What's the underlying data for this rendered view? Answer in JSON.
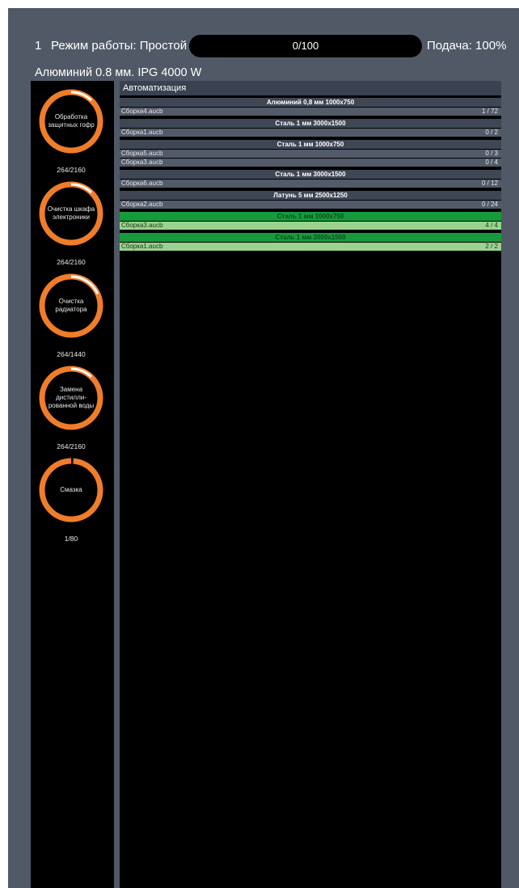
{
  "status": {
    "machine_number": "1",
    "mode_text": "Режим работы: Простой",
    "progress_text": "0/100",
    "progress_fraction": 0,
    "feed_text": "Подача: 100%",
    "material_text": "Алюминий 0.8 мм. IPG 4000 W"
  },
  "maintenance": [
    {
      "label": "Обработка защитных гофр",
      "count": "264/2160",
      "fraction": 0.122
    },
    {
      "label": "Очистка шкафа электроники",
      "count": "264/2160",
      "fraction": 0.122
    },
    {
      "label": "Очистка радиатора",
      "count": "264/1440",
      "fraction": 0.183
    },
    {
      "label": "Замена дистилли-рованной воды",
      "count": "264/2160",
      "fraction": 0.122
    },
    {
      "label": "Смазка",
      "count": "1/80",
      "fraction": 0.0125
    }
  ],
  "automation": {
    "title": "Автоматизация",
    "groups": [
      {
        "title": "Алюминий 0,8 мм 1000x750",
        "done": false,
        "items": [
          {
            "file": "Сборка4.aucb",
            "count": "1 /  72"
          }
        ]
      },
      {
        "title": "Сталь 1 мм 3000x1500",
        "done": false,
        "items": [
          {
            "file": "Сборка1.aucb",
            "count": "0 /  2"
          }
        ]
      },
      {
        "title": "Сталь 1 мм 1000x750",
        "done": false,
        "items": [
          {
            "file": "Сборка5.aucb",
            "count": "0 /  3"
          },
          {
            "file": "Сборка3.aucb",
            "count": "0 /  4"
          }
        ]
      },
      {
        "title": "Сталь 1 мм 3000x1500",
        "done": false,
        "items": [
          {
            "file": "Сборка6.aucb",
            "count": "0 /  12"
          }
        ]
      },
      {
        "title": "Латунь 5 мм 2500x1250",
        "done": false,
        "items": [
          {
            "file": "Сборка2.aucb",
            "count": "0 /  24"
          }
        ]
      },
      {
        "title": "Сталь 1 мм 1000x750",
        "done": true,
        "items": [
          {
            "file": "Сборка3.aucb",
            "count": "4 /  4"
          }
        ]
      },
      {
        "title": "Сталь 1 мм 3000x1500",
        "done": true,
        "items": [
          {
            "file": "Сборка1.aucb",
            "count": "2 /  2"
          }
        ]
      }
    ]
  },
  "colors": {
    "gauge_ring": "#f07d2a",
    "gauge_progress": "#ffffff",
    "done_header": "#179a3c",
    "done_item": "#9bd38e"
  }
}
